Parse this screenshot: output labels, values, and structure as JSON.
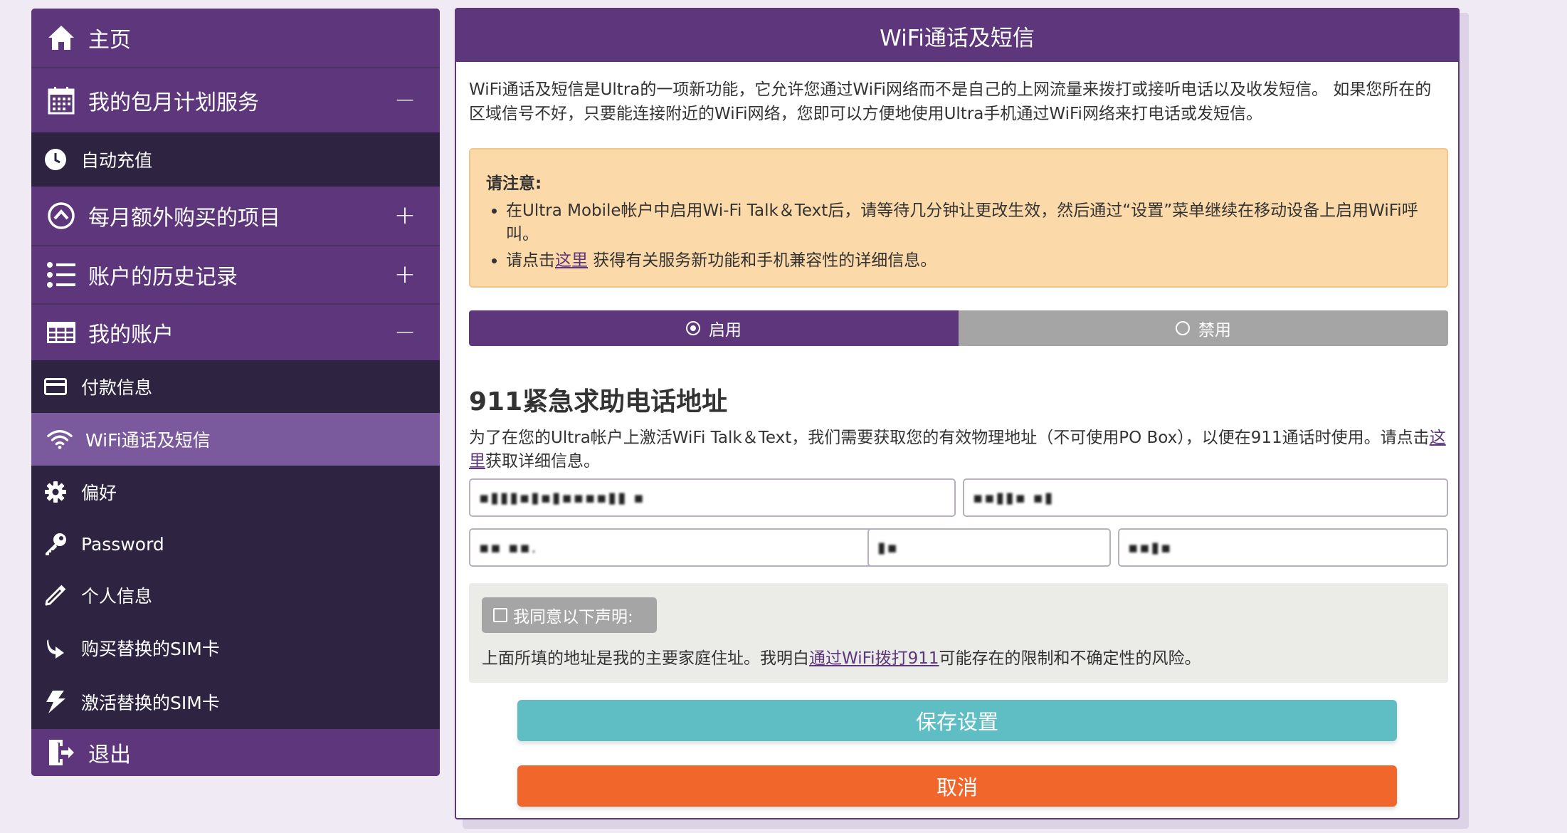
{
  "sidebar": {
    "items": [
      {
        "label": "主页",
        "icon": "home-icon",
        "toggle": ""
      },
      {
        "label": "我的包月计划服务",
        "icon": "calendar-icon",
        "toggle": "−"
      },
      {
        "label": "自动充值",
        "icon": "clock-icon"
      },
      {
        "label": "每月额外购买的项目",
        "icon": "chevron-up-circle-icon",
        "toggle": "+"
      },
      {
        "label": "账户的历史记录",
        "icon": "list-icon",
        "toggle": "+"
      },
      {
        "label": "我的账户",
        "icon": "table-icon",
        "toggle": "−"
      },
      {
        "label": "付款信息",
        "icon": "credit-card-icon"
      },
      {
        "label": "WiFi通话及短信",
        "icon": "wifi-icon"
      },
      {
        "label": "偏好",
        "icon": "gear-icon"
      },
      {
        "label": "Password",
        "icon": "key-icon"
      },
      {
        "label": "个人信息",
        "icon": "pencil-icon"
      },
      {
        "label": "购买替换的SIM卡",
        "icon": "redirect-icon"
      },
      {
        "label": "激活替换的SIM卡",
        "icon": "bolt-icon"
      },
      {
        "label": "退出",
        "icon": "sign-out-icon"
      }
    ]
  },
  "panel": {
    "title": "WiFi通话及短信",
    "intro": "WiFi通话及短信是Ultra的一项新功能，它允许您通过WiFi网络而不是自己的上网流量来拨打或接听电话以及收发短信。 如果您所在的区域信号不好，只要能连接附近的WiFi网络，您即可以方便地使用Ultra手机通过WiFi网络来打电话或发短信。",
    "notice": {
      "title": "请注意:",
      "bullet1": "在Ultra Mobile帐户中启用Wi-Fi Talk＆Text后，请等待几分钟让更改生效，然后通过“设置”菜单继续在移动设备上启用WiFi呼叫。",
      "bullet2_pre": "请点击",
      "bullet2_link": "这里",
      "bullet2_post": " 获得有关服务新功能和手机兼容性的详细信息。"
    },
    "toggle": {
      "on_label": "启用",
      "off_label": "禁用",
      "selected": "启用"
    },
    "e911": {
      "heading": "911紧急求助电话地址",
      "desc_pre": "为了在您的Ultra帐户上激活WiFi Talk＆Text，我们需要获取您的有效物理地址（不可使用PO Box），以便在911通话时使用。请点击",
      "desc_link": "这里",
      "desc_post": "获取详细信息。",
      "fields": {
        "address1": "▪▮▮▮▪▮▪▮▪▪▪▪▮▮ ▪",
        "address2": "▪▪▮▮▪ ▪▮",
        "city": "▪▪ ▪▪.",
        "state": "▮▪",
        "zip": "▪▪▮▪"
      }
    },
    "agree": {
      "checkbox_label": "我同意以下声明:",
      "text_pre": "上面所填的地址是我的主要家庭住址。我明白",
      "text_link": "通过WiFi拨打911",
      "text_post": "可能存在的限制和不确定性的风险。"
    },
    "save_label": "保存设置",
    "cancel_label": "取消"
  },
  "colors": {
    "brand_purple": "#5d367c",
    "sidebar_dark": "#2e2340",
    "active_item": "#7a5a9c",
    "save_teal": "#5ebec4",
    "cancel_orange": "#f0662b",
    "notice_bg": "#fcd9a8"
  }
}
